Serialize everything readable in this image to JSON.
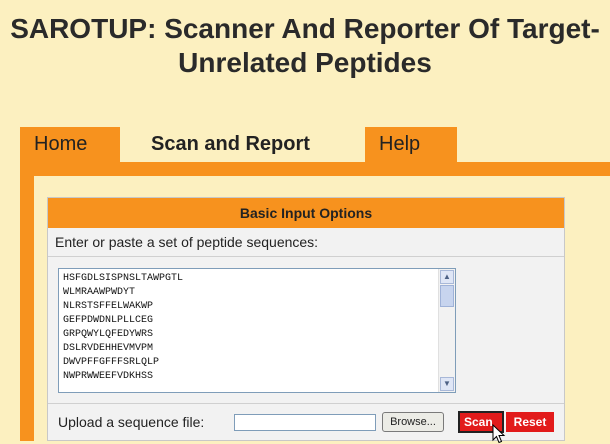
{
  "title": "SAROTUP: Scanner And Reporter Of Target-Unrelated Peptides",
  "tabs": [
    {
      "label": "Home"
    },
    {
      "label": "Scan and Report"
    },
    {
      "label": "Help"
    }
  ],
  "panel": {
    "header": "Basic Input Options",
    "prompt": "Enter or paste a set of peptide sequences:",
    "sequences": [
      "HSFGDLSISPNSLTAWPGTL",
      "WLMRAAWPWDYT",
      "NLRSTSFFELWAKWP",
      "GEFPDWDNLPLLCEG",
      "GRPQWYLQFEDYWRS",
      "DSLRVDEHHEVMVPM",
      "DWVPFFGFFFSRLQLP",
      "NWPRWWEEFVDKHSS"
    ],
    "upload_label": "Upload a sequence file:",
    "file_value": "",
    "browse_label": "Browse...",
    "scan_label": "Scan",
    "reset_label": "Reset"
  },
  "icons": {
    "scroll_up": "scroll-up-arrow-icon",
    "scroll_down": "scroll-down-arrow-icon",
    "cursor": "mouse-pointer-icon"
  },
  "colors": {
    "background": "#fcf0c0",
    "accent": "#f7921e",
    "button_red": "#e21b1b"
  }
}
